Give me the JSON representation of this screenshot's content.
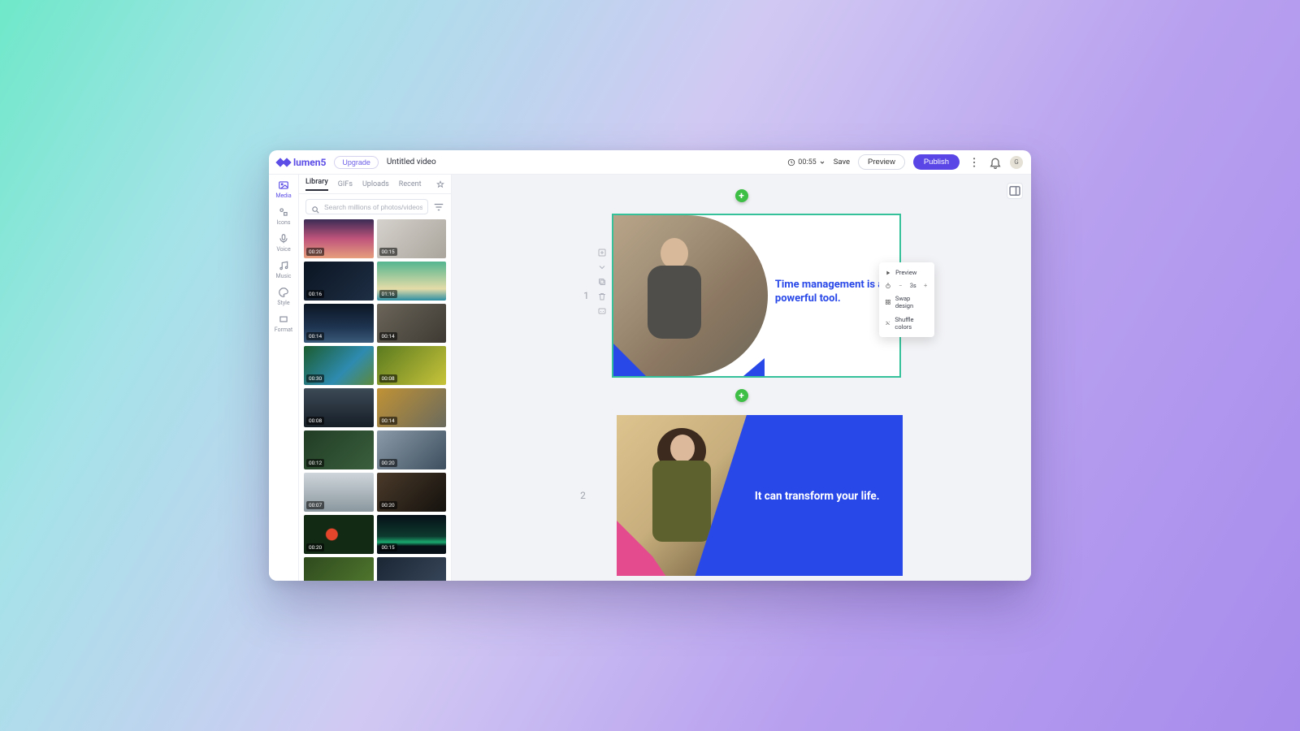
{
  "brand": {
    "name": "lumen5"
  },
  "header": {
    "upgrade": "Upgrade",
    "project_title": "Untitled video",
    "duration": "00:55",
    "save": "Save",
    "preview": "Preview",
    "publish": "Publish",
    "avatar_initial": "G"
  },
  "rail": [
    {
      "id": "media",
      "label": "Media",
      "active": true
    },
    {
      "id": "icons",
      "label": "Icons",
      "active": false
    },
    {
      "id": "voice",
      "label": "Voice",
      "active": false
    },
    {
      "id": "music",
      "label": "Music",
      "active": false
    },
    {
      "id": "style",
      "label": "Style",
      "active": false
    },
    {
      "id": "format",
      "label": "Format",
      "active": false
    }
  ],
  "media_panel": {
    "tabs": {
      "library": "Library",
      "gifs": "GIFs",
      "uploads": "Uploads",
      "recent": "Recent"
    },
    "search_placeholder": "Search millions of photos/videos...",
    "thumbs": [
      {
        "dur": "00:20",
        "cls": "t-sunset"
      },
      {
        "dur": "00:15",
        "cls": "t-street"
      },
      {
        "dur": "00:16",
        "cls": "t-dark1"
      },
      {
        "dur": "01:16",
        "cls": "t-beach"
      },
      {
        "dur": "00:14",
        "cls": "t-cityn"
      },
      {
        "dur": "00:14",
        "cls": "t-workshop"
      },
      {
        "dur": "00:30",
        "cls": "t-river"
      },
      {
        "dur": "00:08",
        "cls": "t-dande"
      },
      {
        "dur": "00:08",
        "cls": "t-crowd"
      },
      {
        "dur": "00:14",
        "cls": "t-constr"
      },
      {
        "dur": "00:12",
        "cls": "t-aerialg"
      },
      {
        "dur": "00:20",
        "cls": "t-aerialb"
      },
      {
        "dur": "00:07",
        "cls": "t-indust"
      },
      {
        "dur": "00:20",
        "cls": "t-desk"
      },
      {
        "dur": "00:20",
        "cls": "t-butter"
      },
      {
        "dur": "00:15",
        "cls": "t-aurora"
      },
      {
        "dur": "",
        "cls": "t-farm"
      },
      {
        "dur": "",
        "cls": "t-faceblu"
      }
    ]
  },
  "scenes": [
    {
      "num": "1",
      "text": "Time management is a powerful tool."
    },
    {
      "num": "2",
      "text": "It can transform your life."
    }
  ],
  "ctx": {
    "preview": "Preview",
    "duration_value": "3s",
    "swap": "Swap design",
    "shuffle": "Shuffle colors"
  }
}
